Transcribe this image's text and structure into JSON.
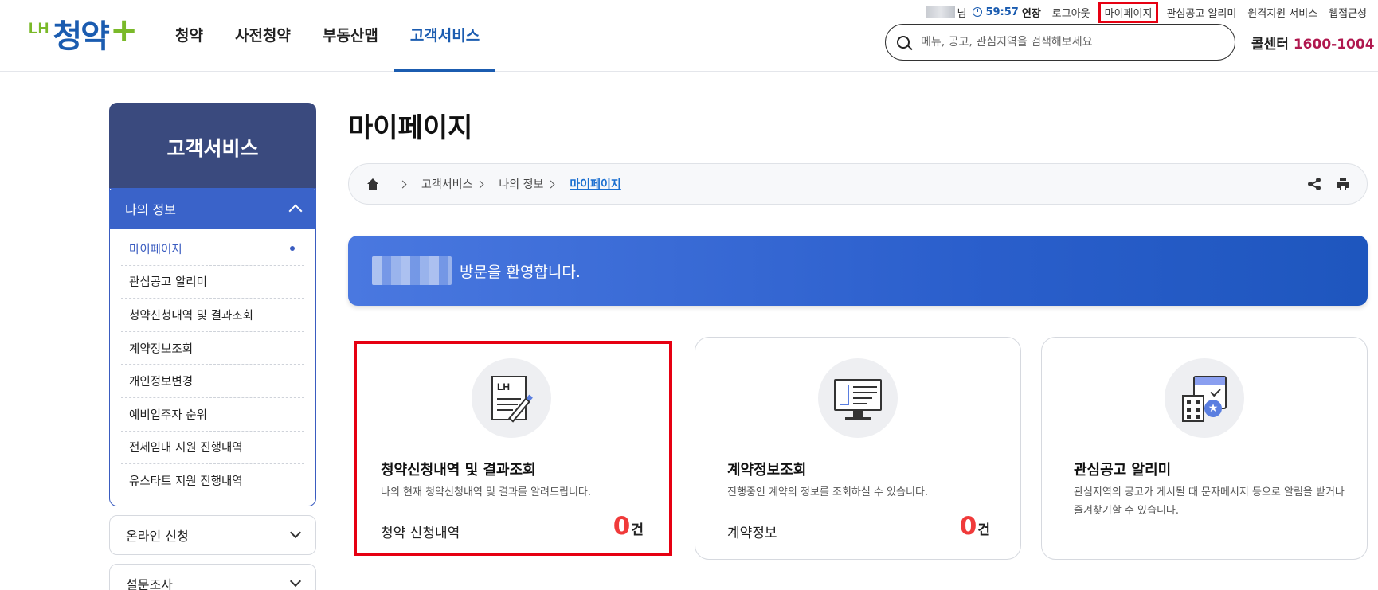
{
  "header": {
    "logo": {
      "lh": "LH",
      "main": "청약",
      "plus": "+"
    },
    "nav": [
      {
        "label": "청약"
      },
      {
        "label": "사전청약"
      },
      {
        "label": "부동산맵"
      },
      {
        "label": "고객서비스"
      }
    ],
    "util": {
      "name_suffix": "님",
      "timer": "59:57",
      "extend": "연장",
      "logout": "로그아웃",
      "mypage": "마이페이지",
      "alert": "관심공고 알리미",
      "remote": "원격지원 서비스",
      "accessibility": "웹접근성"
    },
    "search": {
      "placeholder": "메뉴, 공고, 관심지역을 검색해보세요"
    },
    "callcenter": {
      "label": "콜센터",
      "number": "1600-1004",
      "sep": "|"
    }
  },
  "sidebar": {
    "title": "고객서비스",
    "category": "나의 정보",
    "items": [
      {
        "label": "마이페이지"
      },
      {
        "label": "관심공고 알리미"
      },
      {
        "label": "청약신청내역 및 결과조회"
      },
      {
        "label": "계약정보조회"
      },
      {
        "label": "개인정보변경"
      },
      {
        "label": "예비입주자 순위"
      },
      {
        "label": "전세임대 지원 진행내역"
      },
      {
        "label": "유스타트 지원 진행내역"
      }
    ],
    "folds": [
      {
        "label": "온라인 신청"
      },
      {
        "label": "설문조사"
      }
    ]
  },
  "main": {
    "title": "마이페이지",
    "breadcrumb": [
      "고객서비스",
      "나의 정보",
      "마이페이지"
    ],
    "welcome": "방문을 환영합니다.",
    "cards": [
      {
        "title": "청약신청내역 및 결과조회",
        "desc": "나의 현재 청약신청내역 및 결과를 알려드립니다.",
        "foot_label": "청약 신청내역",
        "count": "0",
        "unit": "건",
        "icon": "application-document-icon"
      },
      {
        "title": "계약정보조회",
        "desc": "진행중인 계약의 정보를 조회하실 수 있습니다.",
        "foot_label": "계약정보",
        "count": "0",
        "unit": "건",
        "icon": "contract-monitor-icon"
      },
      {
        "title": "관심공고 알리미",
        "desc": "관심지역의 공고가 게시될 때 문자메시지 등으로 알림을 받거나 즐겨찾기할 수 있습니다.",
        "icon": "calendar-building-icon"
      }
    ]
  },
  "colors": {
    "brand_blue": "#1b5cb0",
    "brand_green": "#7ab929",
    "highlight_red": "#e60012",
    "count_red": "#f03a3a",
    "sidebar_head": "#3a4a7e"
  }
}
